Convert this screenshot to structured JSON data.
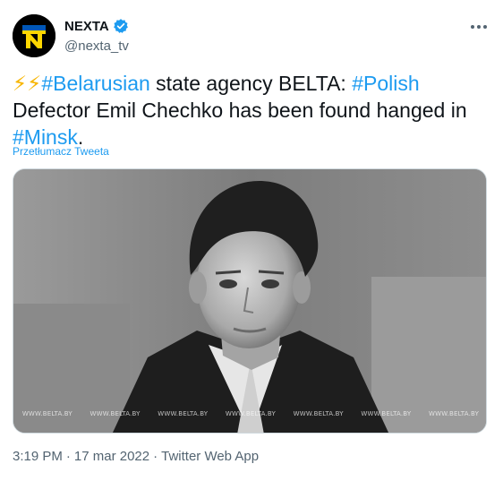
{
  "account": {
    "display_name": "NEXTA",
    "handle": "@nexta_tv",
    "avatar_letter": "N",
    "verified_icon": "verified-badge-icon",
    "accent_color": "#1d9bf0"
  },
  "tweet": {
    "emoji": "⚡⚡",
    "hashtag_1": "#Belarusian",
    "text_1": " state agency BELTA: ",
    "hashtag_2": "#Polish",
    "text_2": "Defector Emil Chechko has been found hanged in ",
    "hashtag_3": "#Minsk",
    "text_3": "."
  },
  "translate_label": "Przetłumacz Tweeta",
  "media": {
    "description_icon": "photo-image",
    "watermark": [
      "WWW.BELTA.BY",
      "WWW.BELTA.BY",
      "WWW.BELTA.BY",
      "WWW.BELTA.BY",
      "WWW.BELTA.BY",
      "WWW.BELTA.BY",
      "WWW.BELTA.BY"
    ]
  },
  "meta": {
    "time": "3:19 PM",
    "separator": "·",
    "date": "17 mar 2022",
    "source": "Twitter Web App"
  }
}
